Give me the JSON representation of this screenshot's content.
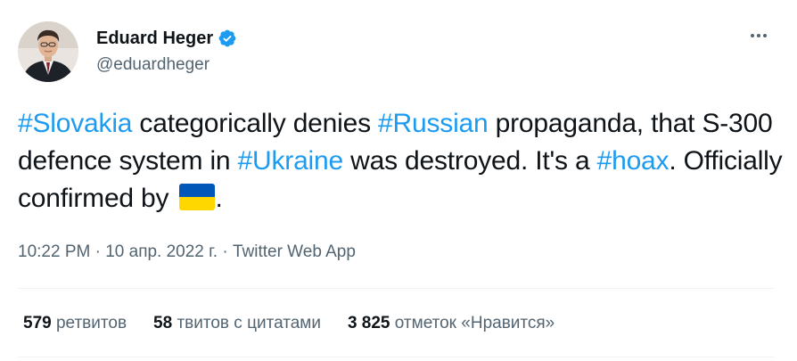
{
  "author": {
    "display_name": "Eduard Heger",
    "handle": "@eduardheger",
    "verified": true
  },
  "tweet": {
    "segments": [
      {
        "text": "#Slovakia",
        "hashtag": true
      },
      {
        "text": " categorically denies ",
        "hashtag": false
      },
      {
        "text": "#Russian",
        "hashtag": true
      },
      {
        "text": " propaganda, that S-300 defence system in ",
        "hashtag": false
      },
      {
        "text": "#Ukraine",
        "hashtag": true
      },
      {
        "text": " was destroyed. It's a ",
        "hashtag": false
      },
      {
        "text": "#hoax",
        "hashtag": true
      },
      {
        "text": ". Officially confirmed by ",
        "hashtag": false
      }
    ],
    "trailing_text": ".",
    "emoji": "ukraine-flag"
  },
  "meta": {
    "time": "10:22 PM",
    "separator1": " · ",
    "date": "10 апр. 2022 г.",
    "separator2": " · ",
    "source": "Twitter Web App"
  },
  "stats": {
    "retweets_count": "579",
    "retweets_label": " ретвитов",
    "quotes_count": "58",
    "quotes_label": " твитов с цитатами",
    "likes_count": "3 825",
    "likes_label": " отметок «Нравится»"
  },
  "colors": {
    "link": "#1d9bf0",
    "text": "#0f1419",
    "secondary": "#536471",
    "flag_blue": "#0057b7",
    "flag_yellow": "#ffd700"
  }
}
